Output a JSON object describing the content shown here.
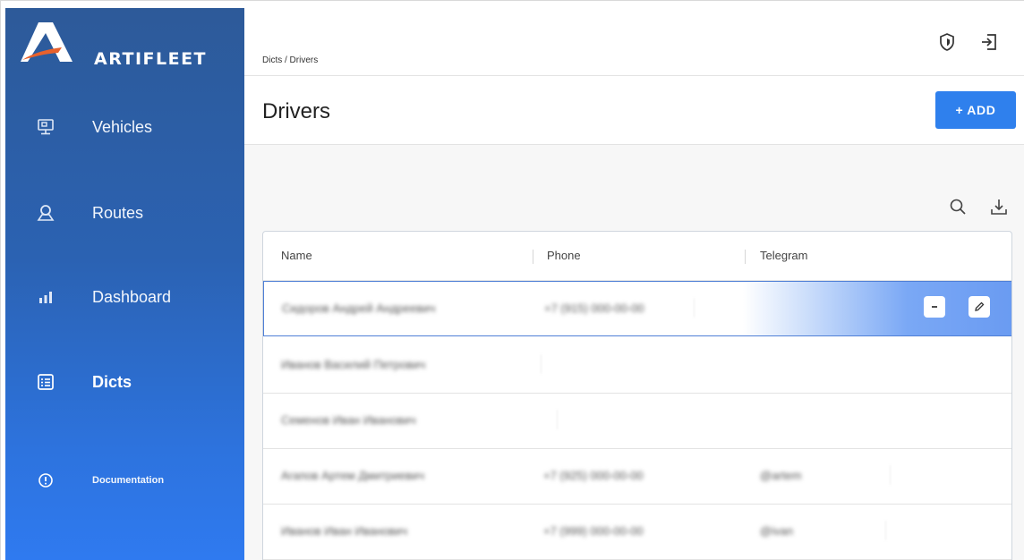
{
  "brand": {
    "name": "ARTIFLEET"
  },
  "sidebar": {
    "items": [
      {
        "label": "Vehicles",
        "icon": "monitor-icon"
      },
      {
        "label": "Routes",
        "icon": "location-icon"
      },
      {
        "label": "Dashboard",
        "icon": "bar-chart-icon"
      },
      {
        "label": "Dicts",
        "icon": "list-icon",
        "active": true
      },
      {
        "label": "Documentation",
        "icon": "info-icon"
      }
    ]
  },
  "header": {
    "breadcrumb": "Dicts / Drivers",
    "icons": [
      "shield-icon",
      "logout-icon"
    ]
  },
  "page": {
    "title": "Drivers",
    "add_label": "+ ADD"
  },
  "toolbar": {
    "icons": [
      "search-icon",
      "download-icon"
    ]
  },
  "table": {
    "columns": [
      "Name",
      "Phone",
      "Telegram"
    ],
    "rows": [
      {
        "name": "Сидоров Андрей Андреевич",
        "phone": "+7 (915) 000-00-00",
        "telegram": "",
        "selected": true
      },
      {
        "name": "Иванов Василий Петрович",
        "phone": "",
        "telegram": ""
      },
      {
        "name": "Семенов Иван Иванович",
        "phone": "",
        "telegram": ""
      },
      {
        "name": "Агапов Артем Дмитриевич",
        "phone": "+7 (925) 000-00-00",
        "telegram": "@artem"
      },
      {
        "name": "Иванов Иван Иванович",
        "phone": "+7 (999) 000-00-00",
        "telegram": "@ivan"
      }
    ]
  },
  "colors": {
    "accent": "#2f80ed",
    "sidebar_top": "#2d5a99",
    "sidebar_bottom": "#2f7af0",
    "logo_orange": "#e8612c"
  }
}
